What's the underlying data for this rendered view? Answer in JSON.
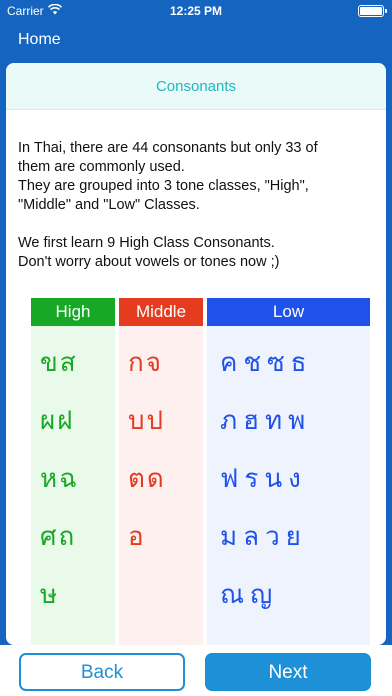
{
  "status_bar": {
    "carrier": "Carrier",
    "time": "12:25 PM",
    "icons": [
      "wifi-icon",
      "battery-icon"
    ]
  },
  "nav": {
    "home_label": "Home"
  },
  "card": {
    "title": "Consonants",
    "intro": {
      "p1_line1": "In Thai, there are 44 consonants but only 33 of",
      "p1_line2": "them are commonly used.",
      "p1_line3": "They are grouped into 3 tone classes, \"High\",",
      "p1_line4": "\"Middle\" and \"Low\" Classes.",
      "p2_line1": "We first learn 9 High Class Consonants.",
      "p2_line2": "Don't worry about vowels or tones now ;)"
    },
    "columns": {
      "high": {
        "label": "High",
        "color": "#17a825",
        "rows": [
          "ขส",
          "ผฝ",
          "หฉ",
          "ศถ",
          "ษ"
        ]
      },
      "middle": {
        "label": "Middle",
        "color": "#e53b1f",
        "rows": [
          "กจ",
          "บป",
          "ตด",
          "อ"
        ]
      },
      "low": {
        "label": "Low",
        "color": "#1f52e8",
        "rows": [
          "คชซธ",
          "ภฮทพ",
          "ฟรนง",
          "มลวย",
          "ณญ"
        ]
      }
    }
  },
  "buttons": {
    "back_label": "Back",
    "next_label": "Next",
    "accent": "#1e90d8"
  }
}
